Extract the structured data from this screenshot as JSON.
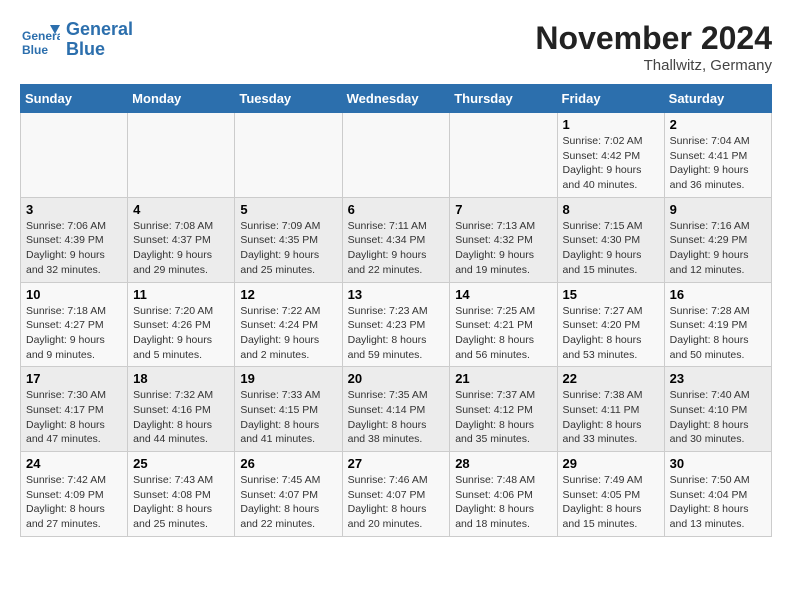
{
  "header": {
    "logo_line1": "General",
    "logo_line2": "Blue",
    "month_title": "November 2024",
    "location": "Thallwitz, Germany"
  },
  "weekdays": [
    "Sunday",
    "Monday",
    "Tuesday",
    "Wednesday",
    "Thursday",
    "Friday",
    "Saturday"
  ],
  "weeks": [
    [
      {
        "day": "",
        "info": ""
      },
      {
        "day": "",
        "info": ""
      },
      {
        "day": "",
        "info": ""
      },
      {
        "day": "",
        "info": ""
      },
      {
        "day": "",
        "info": ""
      },
      {
        "day": "1",
        "info": "Sunrise: 7:02 AM\nSunset: 4:42 PM\nDaylight: 9 hours\nand 40 minutes."
      },
      {
        "day": "2",
        "info": "Sunrise: 7:04 AM\nSunset: 4:41 PM\nDaylight: 9 hours\nand 36 minutes."
      }
    ],
    [
      {
        "day": "3",
        "info": "Sunrise: 7:06 AM\nSunset: 4:39 PM\nDaylight: 9 hours\nand 32 minutes."
      },
      {
        "day": "4",
        "info": "Sunrise: 7:08 AM\nSunset: 4:37 PM\nDaylight: 9 hours\nand 29 minutes."
      },
      {
        "day": "5",
        "info": "Sunrise: 7:09 AM\nSunset: 4:35 PM\nDaylight: 9 hours\nand 25 minutes."
      },
      {
        "day": "6",
        "info": "Sunrise: 7:11 AM\nSunset: 4:34 PM\nDaylight: 9 hours\nand 22 minutes."
      },
      {
        "day": "7",
        "info": "Sunrise: 7:13 AM\nSunset: 4:32 PM\nDaylight: 9 hours\nand 19 minutes."
      },
      {
        "day": "8",
        "info": "Sunrise: 7:15 AM\nSunset: 4:30 PM\nDaylight: 9 hours\nand 15 minutes."
      },
      {
        "day": "9",
        "info": "Sunrise: 7:16 AM\nSunset: 4:29 PM\nDaylight: 9 hours\nand 12 minutes."
      }
    ],
    [
      {
        "day": "10",
        "info": "Sunrise: 7:18 AM\nSunset: 4:27 PM\nDaylight: 9 hours\nand 9 minutes."
      },
      {
        "day": "11",
        "info": "Sunrise: 7:20 AM\nSunset: 4:26 PM\nDaylight: 9 hours\nand 5 minutes."
      },
      {
        "day": "12",
        "info": "Sunrise: 7:22 AM\nSunset: 4:24 PM\nDaylight: 9 hours\nand 2 minutes."
      },
      {
        "day": "13",
        "info": "Sunrise: 7:23 AM\nSunset: 4:23 PM\nDaylight: 8 hours\nand 59 minutes."
      },
      {
        "day": "14",
        "info": "Sunrise: 7:25 AM\nSunset: 4:21 PM\nDaylight: 8 hours\nand 56 minutes."
      },
      {
        "day": "15",
        "info": "Sunrise: 7:27 AM\nSunset: 4:20 PM\nDaylight: 8 hours\nand 53 minutes."
      },
      {
        "day": "16",
        "info": "Sunrise: 7:28 AM\nSunset: 4:19 PM\nDaylight: 8 hours\nand 50 minutes."
      }
    ],
    [
      {
        "day": "17",
        "info": "Sunrise: 7:30 AM\nSunset: 4:17 PM\nDaylight: 8 hours\nand 47 minutes."
      },
      {
        "day": "18",
        "info": "Sunrise: 7:32 AM\nSunset: 4:16 PM\nDaylight: 8 hours\nand 44 minutes."
      },
      {
        "day": "19",
        "info": "Sunrise: 7:33 AM\nSunset: 4:15 PM\nDaylight: 8 hours\nand 41 minutes."
      },
      {
        "day": "20",
        "info": "Sunrise: 7:35 AM\nSunset: 4:14 PM\nDaylight: 8 hours\nand 38 minutes."
      },
      {
        "day": "21",
        "info": "Sunrise: 7:37 AM\nSunset: 4:12 PM\nDaylight: 8 hours\nand 35 minutes."
      },
      {
        "day": "22",
        "info": "Sunrise: 7:38 AM\nSunset: 4:11 PM\nDaylight: 8 hours\nand 33 minutes."
      },
      {
        "day": "23",
        "info": "Sunrise: 7:40 AM\nSunset: 4:10 PM\nDaylight: 8 hours\nand 30 minutes."
      }
    ],
    [
      {
        "day": "24",
        "info": "Sunrise: 7:42 AM\nSunset: 4:09 PM\nDaylight: 8 hours\nand 27 minutes."
      },
      {
        "day": "25",
        "info": "Sunrise: 7:43 AM\nSunset: 4:08 PM\nDaylight: 8 hours\nand 25 minutes."
      },
      {
        "day": "26",
        "info": "Sunrise: 7:45 AM\nSunset: 4:07 PM\nDaylight: 8 hours\nand 22 minutes."
      },
      {
        "day": "27",
        "info": "Sunrise: 7:46 AM\nSunset: 4:07 PM\nDaylight: 8 hours\nand 20 minutes."
      },
      {
        "day": "28",
        "info": "Sunrise: 7:48 AM\nSunset: 4:06 PM\nDaylight: 8 hours\nand 18 minutes."
      },
      {
        "day": "29",
        "info": "Sunrise: 7:49 AM\nSunset: 4:05 PM\nDaylight: 8 hours\nand 15 minutes."
      },
      {
        "day": "30",
        "info": "Sunrise: 7:50 AM\nSunset: 4:04 PM\nDaylight: 8 hours\nand 13 minutes."
      }
    ]
  ]
}
